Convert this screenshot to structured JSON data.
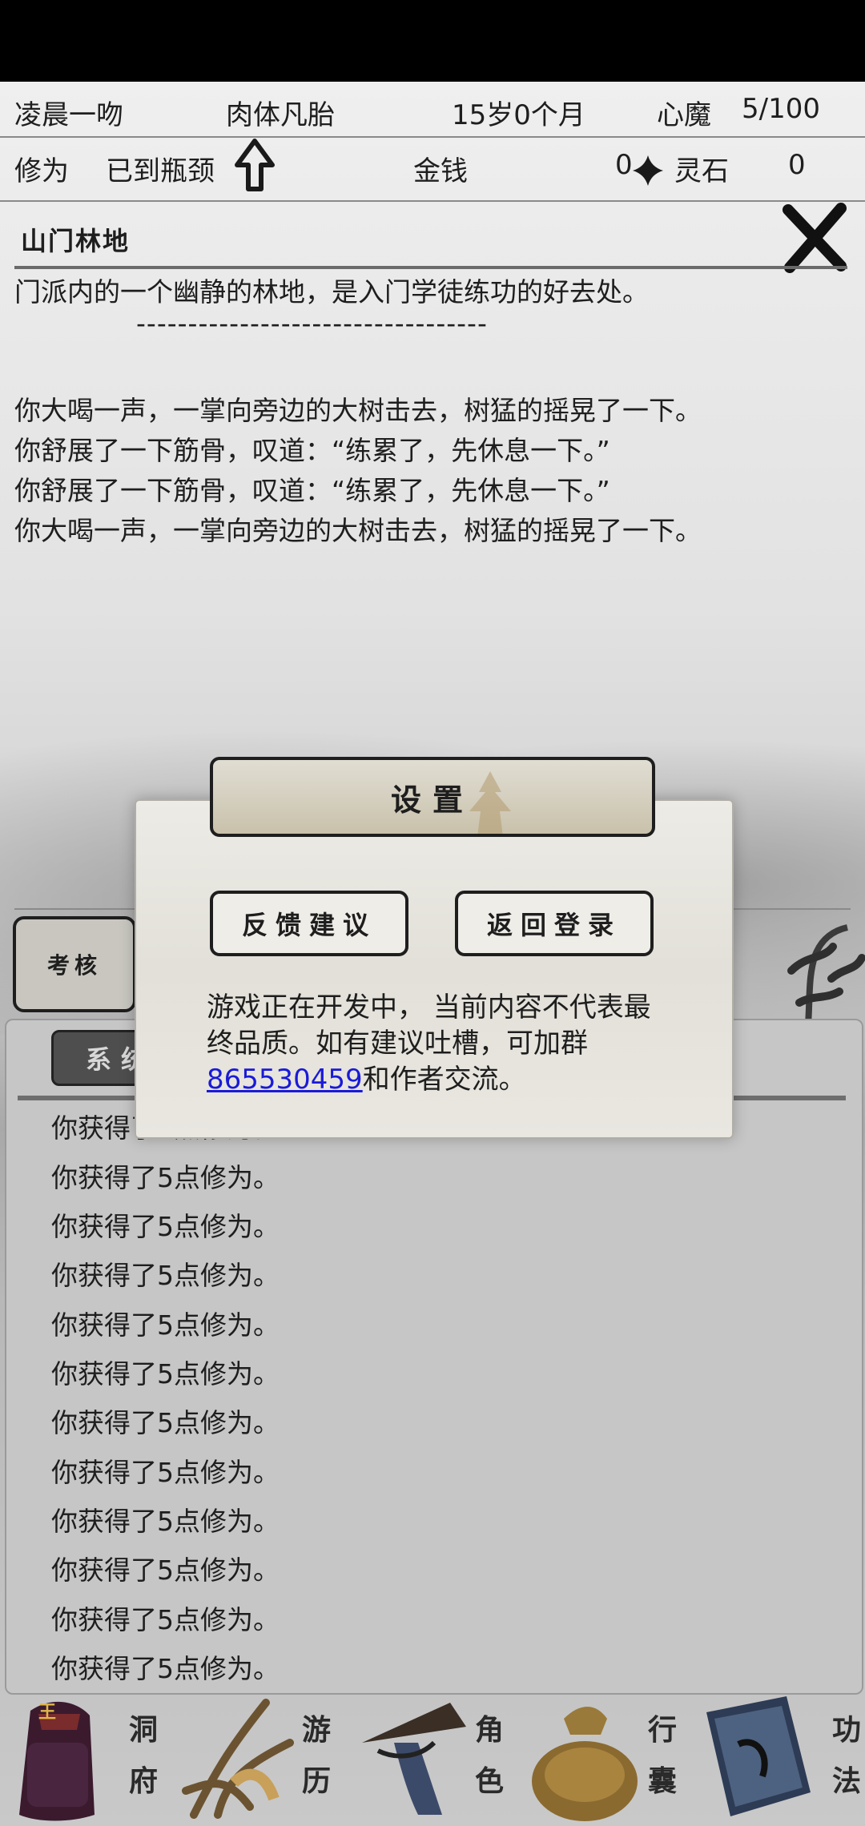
{
  "header": {
    "name": "凌晨一吻",
    "realm": "肉体凡胎",
    "age": "15岁0个月",
    "xinmo_label": "心魔",
    "xinmo_value": "5/100",
    "xiuwei_label": "修为",
    "xiuwei_status": "已到瓶颈",
    "money_label": "金钱",
    "money_value": "0",
    "lingshi_label": "灵石",
    "lingshi_value": "0"
  },
  "location": {
    "title": "山门林地",
    "description": "门派内的一个幽静的林地，是入门学徒练功的好去处。",
    "separator": "----------------------------------",
    "log": [
      "你大喝一声，一掌向旁边的大树击去，树猛的摇晃了一下。",
      "你舒展了一下筋骨，叹道：“练累了，先休息一下。”",
      "你舒展了一下筋骨，叹道：“练累了，先休息一下。”",
      "你大喝一声，一掌向旁边的大树击去，树猛的摇晃了一下。"
    ]
  },
  "exam_button": "考核",
  "system": {
    "tab_label": "系统",
    "messages": [
      "你获得了5点修为。",
      "你获得了5点修为。",
      "你获得了5点修为。",
      "你获得了5点修为。",
      "你获得了5点修为。",
      "你获得了5点修为。",
      "你获得了5点修为。",
      "你获得了5点修为。",
      "你获得了5点修为。",
      "你获得了5点修为。",
      "你获得了5点修为。",
      "你获得了5点修为。"
    ]
  },
  "nav": {
    "items": [
      {
        "top": "洞",
        "bottom": "府",
        "icon": "cave-icon"
      },
      {
        "top": "游",
        "bottom": "历",
        "icon": "travel-icon"
      },
      {
        "top": "角",
        "bottom": "色",
        "icon": "character-icon"
      },
      {
        "top": "行",
        "bottom": "囊",
        "icon": "bag-icon"
      },
      {
        "top": "功",
        "bottom": "法",
        "icon": "book-icon"
      }
    ],
    "badge": "王"
  },
  "modal": {
    "title": "设置",
    "feedback_button": "反馈建议",
    "back_login_button": "返回登录",
    "text_before": "游戏正在开发中， 当前内容不代表最终品质。如有建议吐槽，可加群",
    "group_number": "865530459",
    "text_after": "和作者交流。"
  }
}
